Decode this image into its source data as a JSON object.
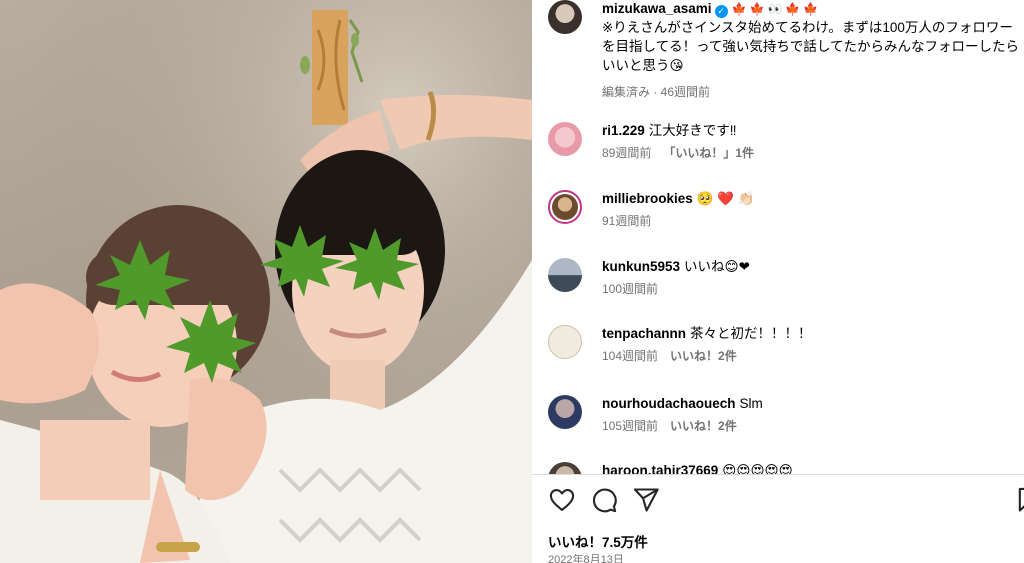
{
  "post": {
    "caption": {
      "username": "mizukawa_asami",
      "emojis": "🍁🍁👀🍁🍁",
      "text": "※りえさんがさインスタ始めてるわけ。まずは100万人のフォロワーを目指してる！って強い気持ちで話してたからみんなフォローしたらいいと思う😘",
      "meta": "編集済み · 46週間前"
    },
    "comments": [
      {
        "username": "ri1.229",
        "text": "江大好きです‼",
        "time": "89週間前",
        "like_label": "「いいね！」1件"
      },
      {
        "username": "milliebrookies",
        "text": "🥺 ❤️ 👏🏻",
        "time": "91週間前",
        "like_label": ""
      },
      {
        "username": "kunkun5953",
        "text": "いいね😊❤",
        "time": "100週間前",
        "like_label": ""
      },
      {
        "username": "tenpachannn",
        "text": "茶々と初だ！！！！",
        "time": "104週間前",
        "like_label": "いいね！2件"
      },
      {
        "username": "nourhoudachaouech",
        "text": "Slm",
        "time": "105週間前",
        "like_label": "いいね！2件"
      },
      {
        "username": "haroon.tahir37669",
        "text": "😍😍😍😍😍",
        "time": "",
        "like_label": ""
      }
    ],
    "likes": "いいね！7.5万件",
    "date": "2022年8月13日"
  },
  "icons": {
    "like": "heart-icon",
    "comment": "comment-icon",
    "share": "paper-plane-icon",
    "save": "bookmark-icon",
    "verified": "verified-badge-icon"
  },
  "colors": {
    "verified": "#0095f6",
    "secondary_text": "#737373",
    "divider": "#dbdbdb"
  }
}
